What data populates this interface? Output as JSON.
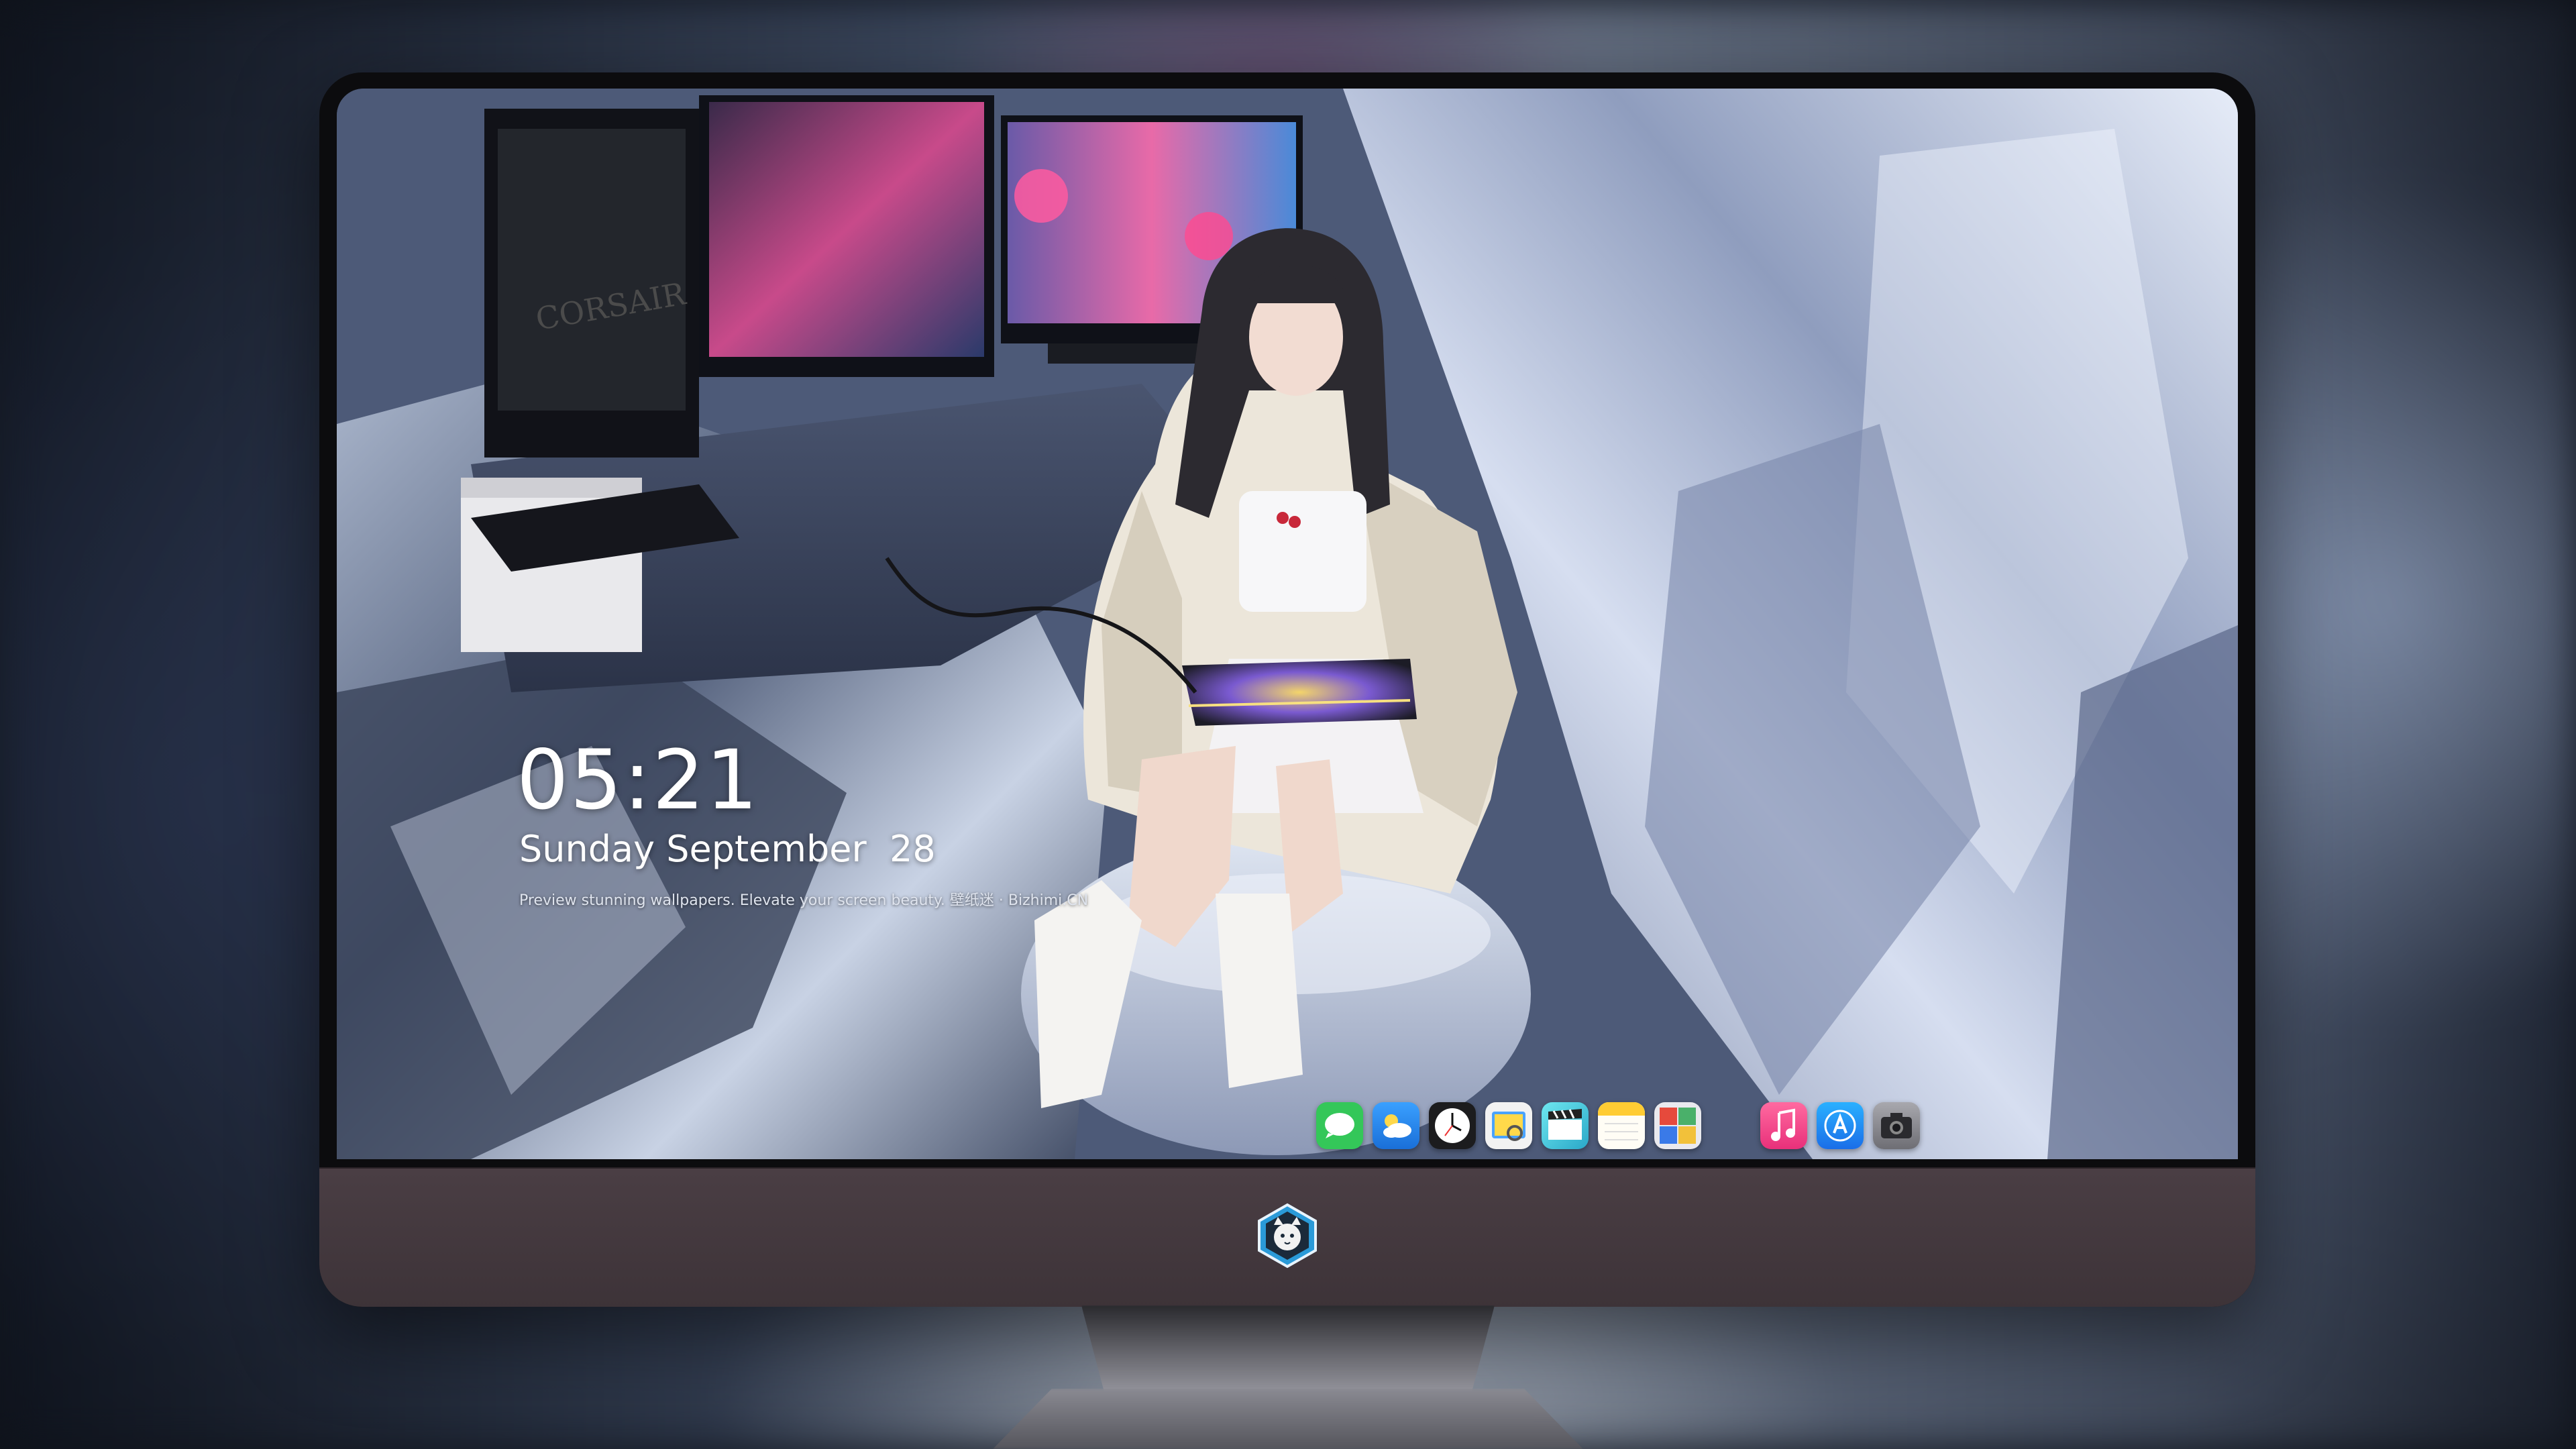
{
  "lock_screen": {
    "time": "05:21",
    "date": "Sunday September  28",
    "caption": "Preview stunning wallpapers. Elevate your screen beauty. 壁纸迷 · Bizhimi.CN"
  },
  "dock": {
    "apps": [
      {
        "name": "messages-icon",
        "color": "#34c759"
      },
      {
        "name": "weather-icon",
        "color": "#2f8df5"
      },
      {
        "name": "clock-icon",
        "color": "#1c1c1e"
      },
      {
        "name": "preview-icon",
        "color": "#f2c14e"
      },
      {
        "name": "final-cut-icon",
        "color": "#4fd1e0"
      },
      {
        "name": "notes-icon",
        "color": "#ffd24d"
      },
      {
        "name": "photo-booth-icon",
        "color": "#e64a3c"
      },
      {
        "name": "music-icon",
        "color": "#fa3c6c"
      },
      {
        "name": "app-store-icon",
        "color": "#1c8cf5"
      },
      {
        "name": "camera-icon",
        "color": "#8e8e93"
      }
    ]
  },
  "monitor": {
    "bezel_color": "#0c0c0e",
    "chin_color": "#433840",
    "logo": "cat-mascot-logo"
  }
}
